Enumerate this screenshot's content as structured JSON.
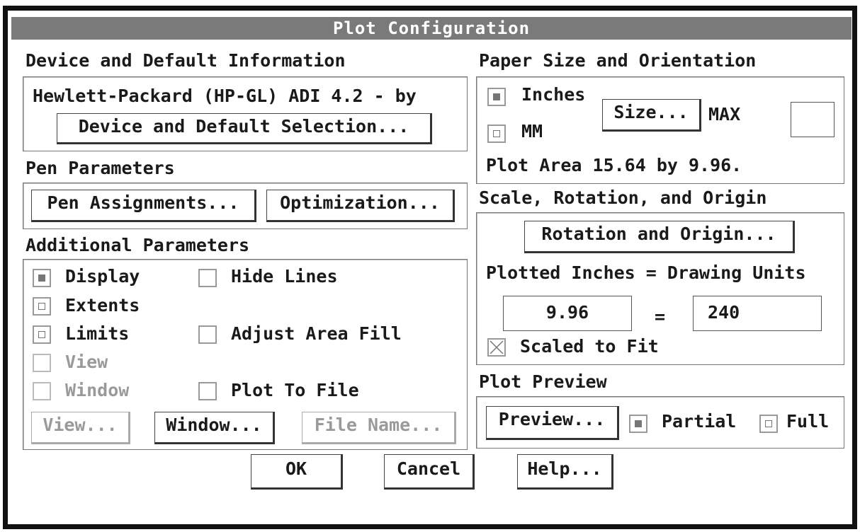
{
  "dialog": {
    "title": "Plot Configuration"
  },
  "device": {
    "heading": "Device and Default Information",
    "name": "Hewlett-Packard (HP-GL) ADI 4.2 - by",
    "select_button": "Device and Default Selection..."
  },
  "pen": {
    "heading": "Pen Parameters",
    "assign_button": "Pen Assignments...",
    "optimize_button": "Optimization..."
  },
  "additional": {
    "heading": "Additional Parameters",
    "display": "Display",
    "extents": "Extents",
    "limits": "Limits",
    "view": "View",
    "window": "Window",
    "hide_lines": "Hide Lines",
    "adjust_fill": "Adjust Area Fill",
    "plot_to_file": "Plot To File",
    "view_button": "View...",
    "window_button": "Window...",
    "file_button": "File Name..."
  },
  "paper": {
    "heading": "Paper Size and Orientation",
    "inches": "Inches",
    "mm": "MM",
    "size_button": "Size...",
    "size_value": "MAX",
    "plot_area": "Plot Area 15.64 by 9.96."
  },
  "scale": {
    "heading": "Scale, Rotation, and Origin",
    "rotation_button": "Rotation and Origin...",
    "units_label": "Plotted Inches = Drawing Units",
    "plotted_inches": "9.96",
    "equals": "=",
    "drawing_units": "240",
    "scaled_to_fit": "Scaled to Fit"
  },
  "preview": {
    "heading": "Plot Preview",
    "preview_button": "Preview...",
    "partial": "Partial",
    "full": "Full"
  },
  "footer": {
    "ok": "OK",
    "cancel": "Cancel",
    "help": "Help..."
  },
  "state": {
    "units": "Inches",
    "area": "Display",
    "preview_mode": "Partial",
    "scaled_to_fit": true,
    "hide_lines": false,
    "adjust_area_fill": false,
    "plot_to_file": false
  }
}
